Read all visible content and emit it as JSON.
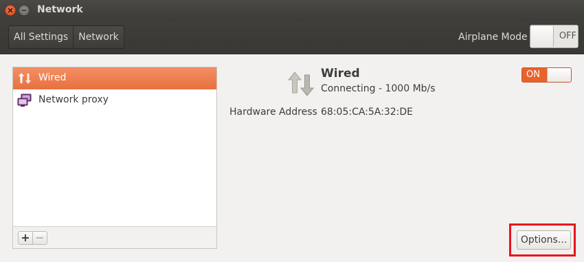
{
  "window": {
    "title": "Network"
  },
  "toolbar": {
    "breadcrumbs": [
      "All Settings",
      "Network"
    ],
    "airplane_mode": {
      "label": "Airplane Mode",
      "state_label": "OFF",
      "enabled": false
    }
  },
  "sidebar": {
    "items": [
      {
        "label": "Wired",
        "icon": "wired-network-icon",
        "selected": true
      },
      {
        "label": "Network proxy",
        "icon": "network-proxy-icon",
        "selected": false
      }
    ],
    "add_label": "+",
    "remove_label": "−"
  },
  "detail": {
    "title": "Wired",
    "status": "Connecting - 1000 Mb/s",
    "hardware_address_label": "Hardware Address",
    "hardware_address": "68:05:CA:5A:32:DE",
    "switch_label": "ON",
    "enabled": true,
    "options_label": "Options..."
  },
  "colors": {
    "accent": "#e9622c",
    "titlebar": "#3d3c38",
    "highlight": "#e8131c"
  }
}
